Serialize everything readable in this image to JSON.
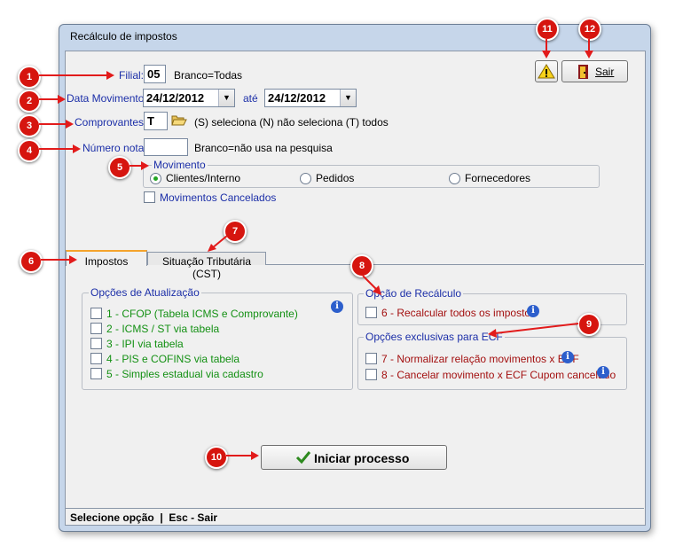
{
  "window": {
    "title": "Recálculo de impostos"
  },
  "form": {
    "filial": {
      "label": "Filial:",
      "value": "05",
      "hint": "Branco=Todas"
    },
    "data_movimento": {
      "label": "Data Movimento:",
      "from": "24/12/2012",
      "sep": "até",
      "to": "24/12/2012"
    },
    "comprovantes": {
      "label": "Comprovantes:",
      "value": "T",
      "hint": "(S) seleciona  (N) não seleciona  (T) todos"
    },
    "numero_nota": {
      "label": "Número nota:",
      "value": "",
      "hint": "Branco=não usa na pesquisa"
    },
    "movimento": {
      "legend": "Movimento",
      "options": [
        "Clientes/Interno",
        "Pedidos",
        "Fornecedores"
      ],
      "selected": "Clientes/Interno"
    },
    "cancelados": {
      "label": "Movimentos Cancelados",
      "checked": false
    }
  },
  "buttons": {
    "sair": "Sair",
    "iniciar": "Iniciar processo"
  },
  "tabs": [
    "Impostos",
    "Situação Tributária (CST)"
  ],
  "opcoes_atualizacao": {
    "legend": "Opções de Atualização",
    "items": [
      "1 - CFOP (Tabela ICMS e Comprovante)",
      "2 - ICMS / ST via tabela",
      "3 - IPI via tabela",
      "4 - PIS e COFINS via tabela",
      "5 - Simples estadual via cadastro"
    ]
  },
  "opcao_recalculo": {
    "legend": "Opção de Recálculo",
    "items": [
      "6 - Recalcular todos os impostos"
    ]
  },
  "opcoes_ecf": {
    "legend": "Opções exclusivas para ECF",
    "items": [
      "7 - Normalizar relação movimentos x ECF",
      "8 - Cancelar movimento x ECF Cupom cancelado"
    ]
  },
  "status_bar": "Selecione opção  |  Esc - Sair",
  "annotations": [
    "1",
    "2",
    "3",
    "4",
    "5",
    "6",
    "7",
    "8",
    "9",
    "10",
    "11",
    "12"
  ],
  "colors": {
    "annotation": "#e21b1b",
    "label_blue": "#1c2fa8",
    "option_green": "#139013",
    "option_red": "#a31010"
  }
}
